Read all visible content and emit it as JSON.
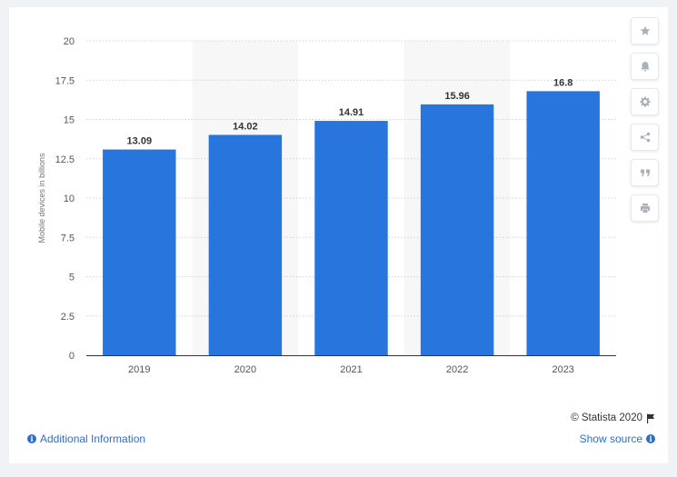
{
  "chart_data": {
    "type": "bar",
    "categories": [
      "2019",
      "2020",
      "2021",
      "2022",
      "2023"
    ],
    "values": [
      13.09,
      14.02,
      14.91,
      15.96,
      16.8
    ],
    "data_labels": [
      "13.09",
      "14.02",
      "14.91",
      "15.96",
      "16.8"
    ],
    "title": "",
    "xlabel": "",
    "ylabel": "Mobile devices in billions",
    "ylim": [
      0,
      20
    ],
    "yticks": [
      "0",
      "2.5",
      "5",
      "7.5",
      "10",
      "12.5",
      "15",
      "17.5",
      "20"
    ],
    "grid": "horizontal dotted",
    "alternating_column_shading": true,
    "bar_color": "#2876dd"
  },
  "toolbar": {
    "items": [
      {
        "name": "star-icon"
      },
      {
        "name": "bell-icon"
      },
      {
        "name": "gear-icon"
      },
      {
        "name": "share-icon"
      },
      {
        "name": "quote-icon"
      },
      {
        "name": "print-icon"
      }
    ]
  },
  "footer": {
    "copyright": "© Statista 2020",
    "additional_info": "Additional Information",
    "show_source": "Show source",
    "link_color": "#2e6ec9"
  }
}
